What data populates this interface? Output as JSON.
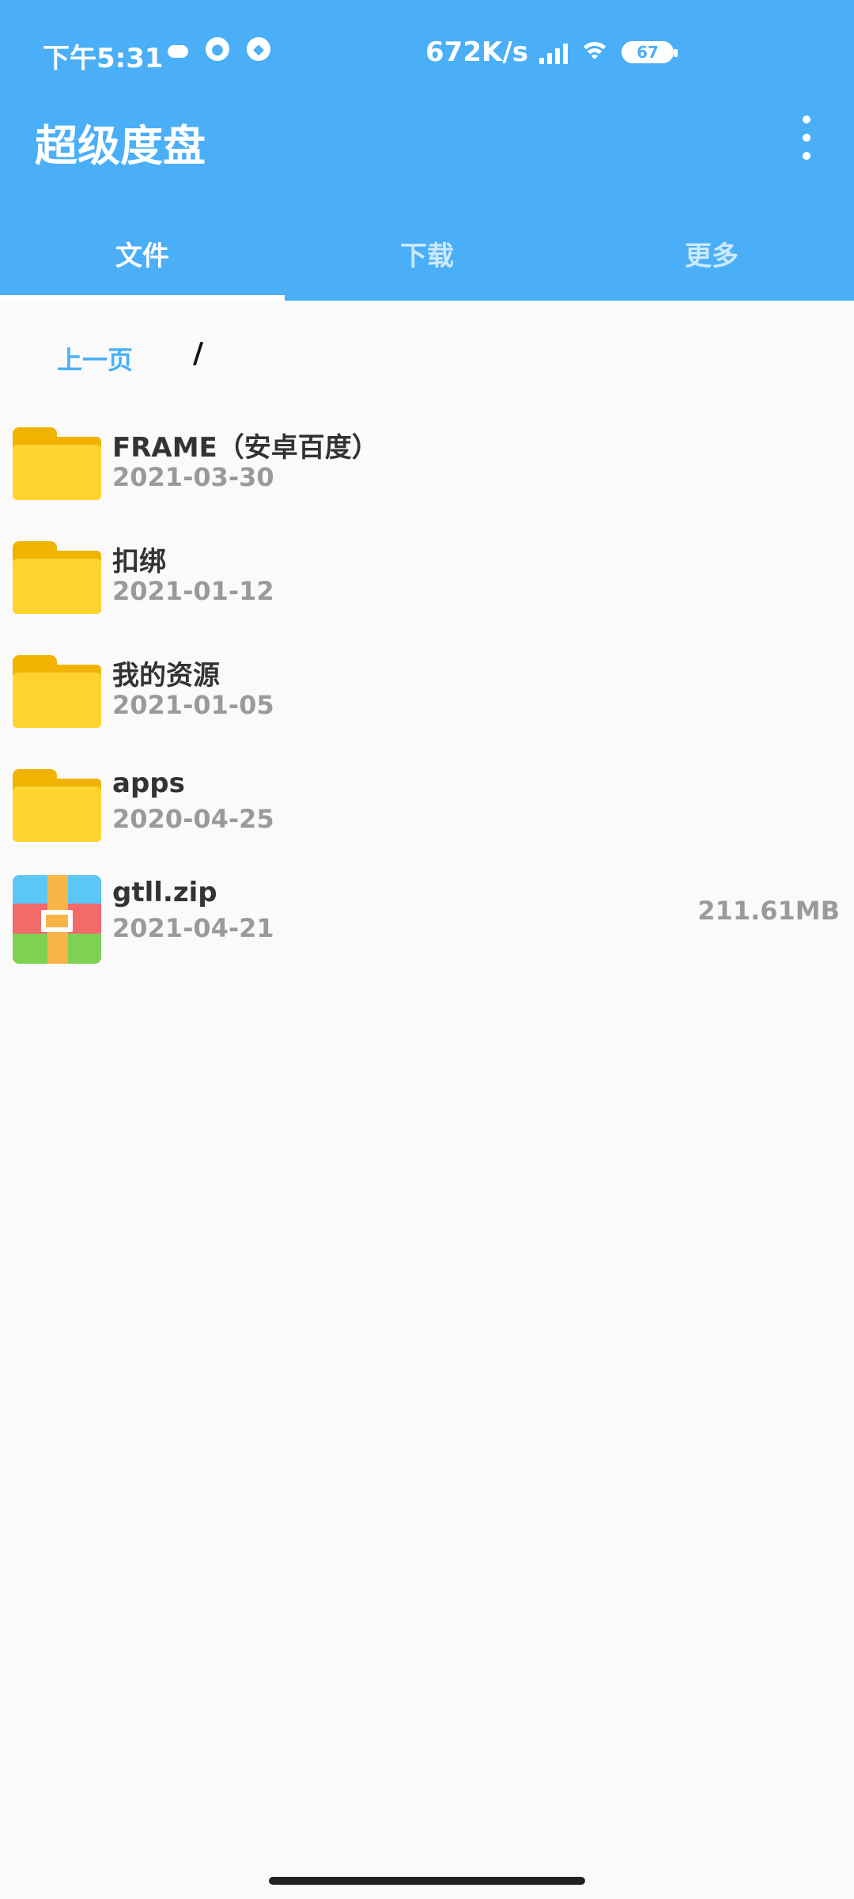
{
  "status_bar": {
    "time": "下午5:31",
    "network_speed": "672K/s",
    "battery": "67",
    "icons": [
      "cloud-icon",
      "qq-icon",
      "qq-alt-icon",
      "signal-icon",
      "wifi-icon",
      "battery-icon"
    ]
  },
  "app": {
    "title": "超级度盘",
    "menu_icon": "more-vert-icon",
    "accent_color": "#4aaff7"
  },
  "tabs": [
    {
      "label": "文件",
      "active": true
    },
    {
      "label": "下载",
      "active": false
    },
    {
      "label": "更多",
      "active": false
    }
  ],
  "breadcrumb": {
    "back_label": "上一页",
    "path": "/"
  },
  "files": [
    {
      "name": "FRAME（安卓百度）",
      "date": "2021-03-30",
      "type": "folder",
      "size": ""
    },
    {
      "name": "扣绑",
      "date": "2021-01-12",
      "type": "folder",
      "size": ""
    },
    {
      "name": "我的资源",
      "date": "2021-01-05",
      "type": "folder",
      "size": ""
    },
    {
      "name": "apps",
      "date": "2020-04-25",
      "type": "folder",
      "size": ""
    },
    {
      "name": "gtll.zip",
      "date": "2021-04-21",
      "type": "zip",
      "size": "211.61MB"
    }
  ]
}
